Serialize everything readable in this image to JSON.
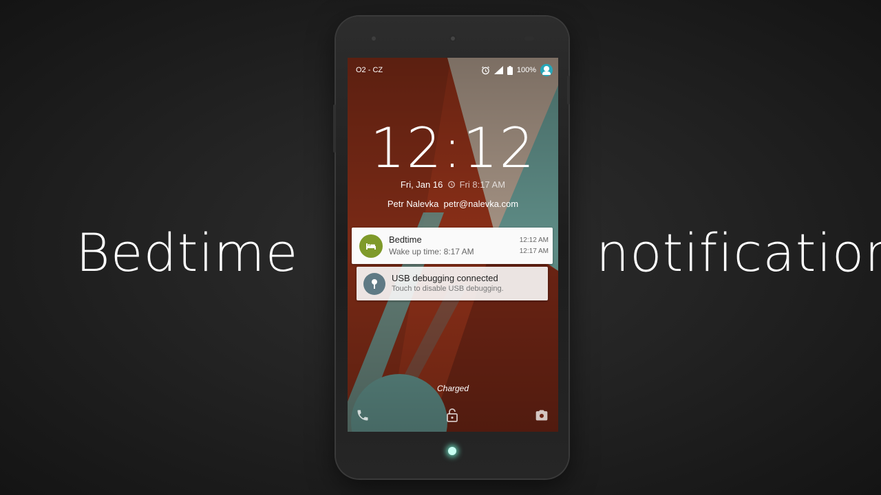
{
  "captions": {
    "left": "Bedtime",
    "right": "notification"
  },
  "status_bar": {
    "carrier": "O2 - CZ",
    "battery": "100%",
    "icons": [
      "alarm-icon",
      "signal-icon",
      "battery-icon",
      "user-avatar-icon"
    ]
  },
  "lockscreen": {
    "time": "12:12",
    "date": "Fri, Jan 16",
    "next_alarm": "Fri 8:17 AM",
    "owner": "Petr Nalevka  petr@nalevka.com",
    "charging_status": "Charged"
  },
  "notifications": [
    {
      "title": "Bedtime",
      "text": "Wake up time: 8:17 AM",
      "times": [
        "12:12 AM",
        "12:17 AM"
      ],
      "icon": "bed-icon",
      "icon_color": "#7f9a2a"
    },
    {
      "title": "USB debugging connected",
      "text": "Touch to disable USB debugging.",
      "icon": "usb-debug-icon",
      "icon_color": "#5f7a85"
    }
  ],
  "bottom_actions": [
    "phone-icon",
    "unlock-icon",
    "camera-icon"
  ],
  "colors": {
    "wallpaper_red": "#8a2f18",
    "wallpaper_teal": "#5e8c86",
    "wallpaper_beige": "#a59384"
  }
}
